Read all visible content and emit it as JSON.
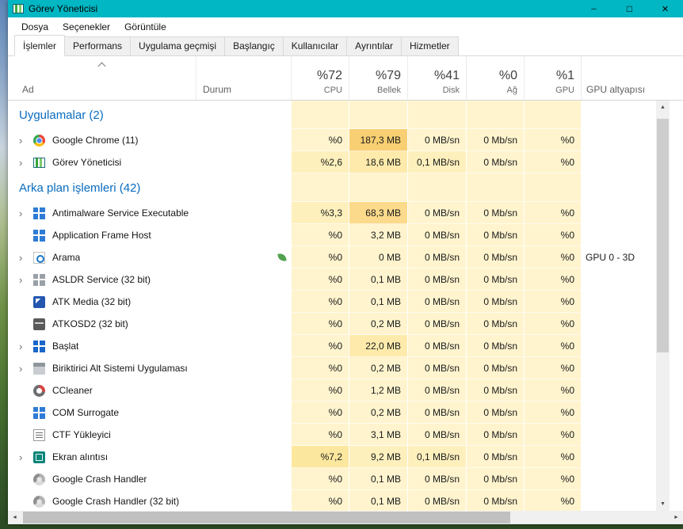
{
  "window": {
    "title": "Görev Yöneticisi",
    "accent_color": "#00B7C3",
    "controls": [
      "minimize",
      "maximize",
      "close"
    ]
  },
  "menu": {
    "items": [
      "Dosya",
      "Seçenekler",
      "Görüntüle"
    ]
  },
  "tabs": [
    {
      "label": "İşlemler",
      "selected": true
    },
    {
      "label": "Performans",
      "selected": false
    },
    {
      "label": "Uygulama geçmişi",
      "selected": false
    },
    {
      "label": "Başlangıç",
      "selected": false
    },
    {
      "label": "Kullanıcılar",
      "selected": false
    },
    {
      "label": "Ayrıntılar",
      "selected": false
    },
    {
      "label": "Hizmetler",
      "selected": false
    }
  ],
  "heat_palette": {
    "0": "#FFF4CE",
    "1": "#FEF0BD",
    "2": "#FEEBAC",
    "3": "#FCE79E",
    "4": "#FBDA8B",
    "5": "#F8CF72"
  },
  "process_table": {
    "columns": {
      "name": "Ad",
      "status": "Durum",
      "metrics": [
        {
          "key": "cpu",
          "pct": "%72",
          "label": "CPU"
        },
        {
          "key": "mem",
          "pct": "%79",
          "label": "Bellek"
        },
        {
          "key": "disk",
          "pct": "%41",
          "label": "Disk"
        },
        {
          "key": "net",
          "pct": "%0",
          "label": "Ağ"
        },
        {
          "key": "gpu",
          "pct": "%1",
          "label": "GPU"
        }
      ],
      "gpu_engine": "GPU altyapısı"
    },
    "rows": [
      {
        "type": "group",
        "label": "Uygulamalar (2)"
      },
      {
        "type": "proc",
        "name": "Google Chrome (11)",
        "chevron": true,
        "icon": "chrome-icon",
        "cpu": "%0",
        "mem": "187,3 MB",
        "disk": "0 MB/sn",
        "net": "0 Mb/sn",
        "gpu": "%0",
        "gpu_engine": "",
        "heat": {
          "cpu": 0,
          "mem": 5,
          "disk": 0,
          "net": 0,
          "gpu": 0
        }
      },
      {
        "type": "proc",
        "name": "Görev Yöneticisi",
        "chevron": true,
        "icon": "taskmgr-icon",
        "cpu": "%2,6",
        "mem": "18,6 MB",
        "disk": "0,1 MB/sn",
        "net": "0 Mb/sn",
        "gpu": "%0",
        "gpu_engine": "",
        "heat": {
          "cpu": 1,
          "mem": 2,
          "disk": 1,
          "net": 0,
          "gpu": 0
        }
      },
      {
        "type": "group",
        "label": "Arka plan işlemleri (42)"
      },
      {
        "type": "proc",
        "name": "Antimalware Service Executable",
        "chevron": true,
        "icon": "defender-icon",
        "cpu": "%3,3",
        "mem": "68,3 MB",
        "disk": "0 MB/sn",
        "net": "0 Mb/sn",
        "gpu": "%0",
        "gpu_engine": "",
        "heat": {
          "cpu": 1,
          "mem": 4,
          "disk": 0,
          "net": 0,
          "gpu": 0
        }
      },
      {
        "type": "proc",
        "name": "Application Frame Host",
        "chevron": false,
        "icon": "frame-host-icon",
        "cpu": "%0",
        "mem": "3,2 MB",
        "disk": "0 MB/sn",
        "net": "0 Mb/sn",
        "gpu": "%0",
        "gpu_engine": "",
        "heat": {
          "cpu": 0,
          "mem": 0,
          "disk": 0,
          "net": 0,
          "gpu": 0
        }
      },
      {
        "type": "proc",
        "name": "Arama",
        "chevron": true,
        "icon": "search-icon",
        "leaf": true,
        "cpu": "%0",
        "mem": "0 MB",
        "disk": "0 MB/sn",
        "net": "0 Mb/sn",
        "gpu": "%0",
        "gpu_engine": "GPU 0 - 3D",
        "heat": {
          "cpu": 0,
          "mem": 0,
          "disk": 0,
          "net": 0,
          "gpu": 0
        }
      },
      {
        "type": "proc",
        "name": "ASLDR Service (32 bit)",
        "chevron": true,
        "icon": "window-icon-gray",
        "cpu": "%0",
        "mem": "0,1 MB",
        "disk": "0 MB/sn",
        "net": "0 Mb/sn",
        "gpu": "%0",
        "gpu_engine": "",
        "heat": {
          "cpu": 0,
          "mem": 0,
          "disk": 0,
          "net": 0,
          "gpu": 0
        }
      },
      {
        "type": "proc",
        "name": "ATK Media (32 bit)",
        "chevron": false,
        "icon": "atk-media-icon",
        "cpu": "%0",
        "mem": "0,1 MB",
        "disk": "0 MB/sn",
        "net": "0 Mb/sn",
        "gpu": "%0",
        "gpu_engine": "",
        "heat": {
          "cpu": 0,
          "mem": 0,
          "disk": 0,
          "net": 0,
          "gpu": 0
        }
      },
      {
        "type": "proc",
        "name": "ATKOSD2 (32 bit)",
        "chevron": false,
        "icon": "atkosd-icon",
        "cpu": "%0",
        "mem": "0,2 MB",
        "disk": "0 MB/sn",
        "net": "0 Mb/sn",
        "gpu": "%0",
        "gpu_engine": "",
        "heat": {
          "cpu": 0,
          "mem": 0,
          "disk": 0,
          "net": 0,
          "gpu": 0
        }
      },
      {
        "type": "proc",
        "name": "Başlat",
        "chevron": true,
        "icon": "start-icon",
        "cpu": "%0",
        "mem": "22,0 MB",
        "disk": "0 MB/sn",
        "net": "0 Mb/sn",
        "gpu": "%0",
        "gpu_engine": "",
        "heat": {
          "cpu": 0,
          "mem": 2,
          "disk": 0,
          "net": 0,
          "gpu": 0
        }
      },
      {
        "type": "proc",
        "name": "Biriktirici Alt Sistemi Uygulaması",
        "chevron": true,
        "icon": "spooler-icon",
        "cpu": "%0",
        "mem": "0,2 MB",
        "disk": "0 MB/sn",
        "net": "0 Mb/sn",
        "gpu": "%0",
        "gpu_engine": "",
        "heat": {
          "cpu": 0,
          "mem": 0,
          "disk": 0,
          "net": 0,
          "gpu": 0
        }
      },
      {
        "type": "proc",
        "name": "CCleaner",
        "chevron": false,
        "icon": "ccleaner-icon",
        "cpu": "%0",
        "mem": "1,2 MB",
        "disk": "0 MB/sn",
        "net": "0 Mb/sn",
        "gpu": "%0",
        "gpu_engine": "",
        "heat": {
          "cpu": 0,
          "mem": 0,
          "disk": 0,
          "net": 0,
          "gpu": 0
        }
      },
      {
        "type": "proc",
        "name": "COM Surrogate",
        "chevron": false,
        "icon": "com-surrogate-icon",
        "cpu": "%0",
        "mem": "0,2 MB",
        "disk": "0 MB/sn",
        "net": "0 Mb/sn",
        "gpu": "%0",
        "gpu_engine": "",
        "heat": {
          "cpu": 0,
          "mem": 0,
          "disk": 0,
          "net": 0,
          "gpu": 0
        }
      },
      {
        "type": "proc",
        "name": "CTF Yükleyici",
        "chevron": false,
        "icon": "ctf-loader-icon",
        "cpu": "%0",
        "mem": "3,1 MB",
        "disk": "0 MB/sn",
        "net": "0 Mb/sn",
        "gpu": "%0",
        "gpu_engine": "",
        "heat": {
          "cpu": 0,
          "mem": 0,
          "disk": 0,
          "net": 0,
          "gpu": 0
        }
      },
      {
        "type": "proc",
        "name": "Ekran alıntısı",
        "chevron": true,
        "icon": "snip-icon",
        "cpu": "%7,2",
        "mem": "9,2 MB",
        "disk": "0,1 MB/sn",
        "net": "0 Mb/sn",
        "gpu": "%0",
        "gpu_engine": "",
        "heat": {
          "cpu": 3,
          "mem": 1,
          "disk": 1,
          "net": 0,
          "gpu": 0
        }
      },
      {
        "type": "proc",
        "name": "Google Crash Handler",
        "chevron": false,
        "icon": "crash-handler-icon",
        "cpu": "%0",
        "mem": "0,1 MB",
        "disk": "0 MB/sn",
        "net": "0 Mb/sn",
        "gpu": "%0",
        "gpu_engine": "",
        "heat": {
          "cpu": 0,
          "mem": 0,
          "disk": 0,
          "net": 0,
          "gpu": 0
        }
      },
      {
        "type": "proc",
        "name": "Google Crash Handler (32 bit)",
        "chevron": false,
        "icon": "crash-handler-icon",
        "cpu": "%0",
        "mem": "0,1 MB",
        "disk": "0 MB/sn",
        "net": "0 Mb/sn",
        "gpu": "%0",
        "gpu_engine": "",
        "heat": {
          "cpu": 0,
          "mem": 0,
          "disk": 0,
          "net": 0,
          "gpu": 0
        }
      }
    ]
  }
}
